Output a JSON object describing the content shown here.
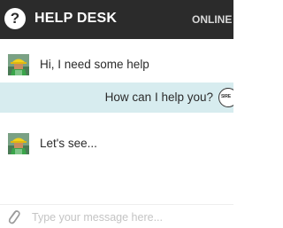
{
  "header": {
    "help_icon_glyph": "?",
    "title": "HELP DESK",
    "status": "ONLINE"
  },
  "messages": [
    {
      "sender": "agent",
      "text": "Hi, I need some help"
    },
    {
      "sender": "user",
      "text": "How can I help you?",
      "avatar_text": "SIRE"
    },
    {
      "sender": "agent",
      "text": "Let's see..."
    }
  ],
  "composer": {
    "placeholder": "Type your message here...",
    "attach_icon": "paperclip-icon"
  },
  "colors": {
    "header_bg": "#2b2b2b",
    "user_message_bg": "#d7ecef",
    "agent_hat": "#f2d21e",
    "agent_vest": "#3aa54a"
  }
}
